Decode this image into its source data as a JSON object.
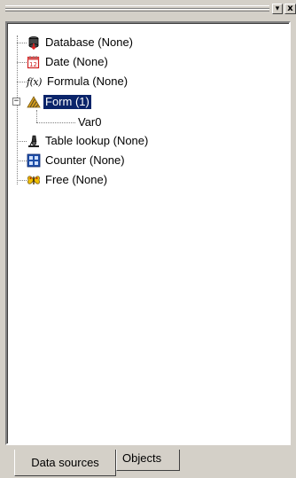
{
  "panel": {
    "dropdown_glyph": "▾",
    "close_glyph": "x"
  },
  "tree": {
    "nodes": [
      {
        "label": "Database (None)",
        "icon": "database-icon"
      },
      {
        "label": "Date (None)",
        "icon": "calendar-icon"
      },
      {
        "label": "Formula (None)",
        "icon": "function-icon",
        "icon_text": "f(x)"
      },
      {
        "label": "Form (1)",
        "icon": "form-icon",
        "selected": true,
        "expanded": true,
        "expander": "−",
        "children": [
          {
            "label": "Var0"
          }
        ]
      },
      {
        "label": "Table lookup (None)",
        "icon": "lookup-icon"
      },
      {
        "label": "Counter (None)",
        "icon": "counter-icon"
      },
      {
        "label": "Free (None)",
        "icon": "free-icon"
      }
    ]
  },
  "tabs": [
    {
      "label": "Data sources",
      "active": true
    },
    {
      "label": "Objects",
      "active": false
    }
  ],
  "colors": {
    "selection": "#0a246a",
    "face": "#d4d0c8"
  }
}
